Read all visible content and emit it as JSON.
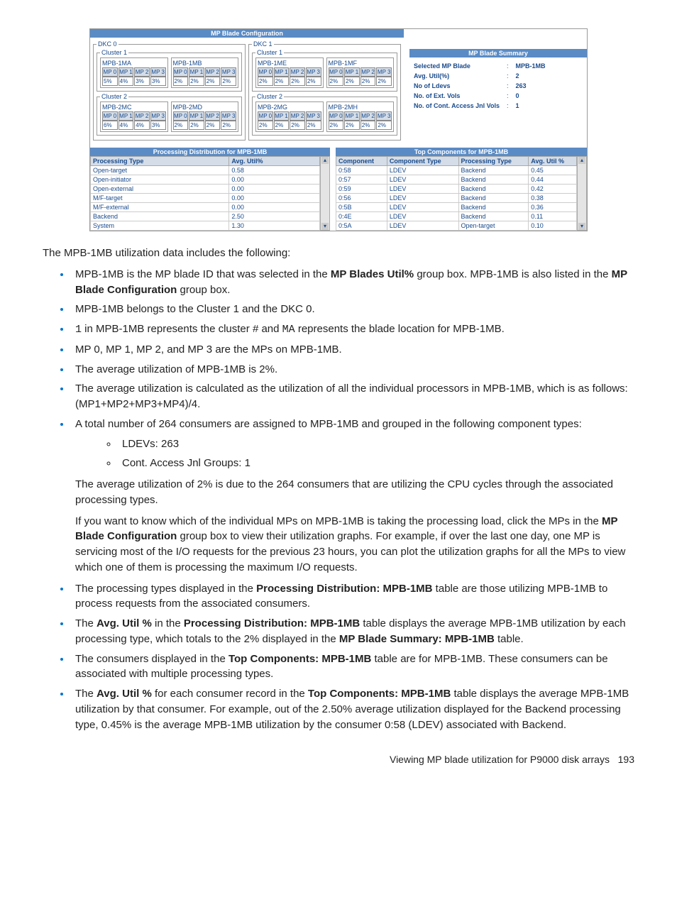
{
  "screenshot": {
    "title": "MP Blade Configuration",
    "dkcs": [
      {
        "label": "DKC 0",
        "clusters": [
          {
            "label": "Cluster 1",
            "blades": [
              {
                "name": "MPB-1MA",
                "mps": [
                  "MP 0",
                  "MP 1",
                  "MP 2",
                  "MP 3"
                ],
                "vals": [
                  "5%",
                  "4%",
                  "3%",
                  "3%"
                ]
              },
              {
                "name": "MPB-1MB",
                "mps": [
                  "MP 0",
                  "MP 1",
                  "MP 2",
                  "MP 3"
                ],
                "vals": [
                  "2%",
                  "2%",
                  "2%",
                  "2%"
                ]
              }
            ]
          },
          {
            "label": "Cluster 2",
            "blades": [
              {
                "name": "MPB-2MC",
                "mps": [
                  "MP 0",
                  "MP 1",
                  "MP 2",
                  "MP 3"
                ],
                "vals": [
                  "6%",
                  "4%",
                  "4%",
                  "3%"
                ]
              },
              {
                "name": "MPB-2MD",
                "mps": [
                  "MP 0",
                  "MP 1",
                  "MP 2",
                  "MP 3"
                ],
                "vals": [
                  "2%",
                  "2%",
                  "2%",
                  "2%"
                ]
              }
            ]
          }
        ]
      },
      {
        "label": "DKC 1",
        "clusters": [
          {
            "label": "Cluster 1",
            "blades": [
              {
                "name": "MPB-1ME",
                "mps": [
                  "MP 0",
                  "MP 1",
                  "MP 2",
                  "MP 3"
                ],
                "vals": [
                  "2%",
                  "2%",
                  "2%",
                  "2%"
                ]
              },
              {
                "name": "MPB-1MF",
                "mps": [
                  "MP 0",
                  "MP 1",
                  "MP 2",
                  "MP 3"
                ],
                "vals": [
                  "2%",
                  "2%",
                  "2%",
                  "2%"
                ]
              }
            ]
          },
          {
            "label": "Cluster 2",
            "blades": [
              {
                "name": "MPB-2MG",
                "mps": [
                  "MP 0",
                  "MP 1",
                  "MP 2",
                  "MP 3"
                ],
                "vals": [
                  "2%",
                  "2%",
                  "2%",
                  "2%"
                ]
              },
              {
                "name": "MPB-2MH",
                "mps": [
                  "MP 0",
                  "MP 1",
                  "MP 2",
                  "MP 3"
                ],
                "vals": [
                  "2%",
                  "2%",
                  "2%",
                  "2%"
                ]
              }
            ]
          }
        ]
      }
    ],
    "summary": {
      "header": "MP Blade Summary",
      "rows": [
        {
          "label": "Selected MP Blade",
          "value": "MPB-1MB"
        },
        {
          "label": "Avg. Util(%)",
          "value": "2"
        },
        {
          "label": "No of Ldevs",
          "value": "263"
        },
        {
          "label": "No. of Ext. Vols",
          "value": "0"
        },
        {
          "label": "No. of Cont. Access Jnl Vols",
          "value": "1"
        }
      ]
    },
    "procDist": {
      "header": "Processing Distribution for MPB-1MB",
      "cols": [
        "Processing Type",
        "Avg. Util%"
      ],
      "rows": [
        [
          "Open-target",
          "0.58"
        ],
        [
          "Open-initiator",
          "0.00"
        ],
        [
          "Open-external",
          "0.00"
        ],
        [
          "M/F-target",
          "0.00"
        ],
        [
          "M/F-external",
          "0.00"
        ],
        [
          "Backend",
          "2.50"
        ],
        [
          "System",
          "1.30"
        ]
      ]
    },
    "topComp": {
      "header": "Top Components for MPB-1MB",
      "cols": [
        "Component",
        "Component Type",
        "Processing Type",
        "Avg. Util %"
      ],
      "rows": [
        [
          "0:58",
          "LDEV",
          "Backend",
          "0.45"
        ],
        [
          "0:57",
          "LDEV",
          "Backend",
          "0.44"
        ],
        [
          "0:59",
          "LDEV",
          "Backend",
          "0.42"
        ],
        [
          "0:56",
          "LDEV",
          "Backend",
          "0.38"
        ],
        [
          "0:5B",
          "LDEV",
          "Backend",
          "0.36"
        ],
        [
          "0:4E",
          "LDEV",
          "Backend",
          "0.11"
        ],
        [
          "0:5A",
          "LDEV",
          "Open-target",
          "0.10"
        ]
      ]
    }
  },
  "text": {
    "intro": "The MPB-1MB utilization data includes the following:",
    "b1a": "MPB-1MB is the MP blade ID that was selected in the ",
    "b1b": "MP Blades Util%",
    "b1c": " group box. MPB-1MB is also listed in the ",
    "b1d": "MP Blade Configuration",
    "b1e": " group box.",
    "b2": "MPB-1MB belongs to the Cluster 1 and the DKC 0.",
    "b3a": "1",
    "b3b": " in MPB-1MB represents the cluster # and ",
    "b3c": "MA",
    "b3d": " represents the blade location for MPB-1MB.",
    "b4": "MP 0, MP 1, MP 2, and MP 3 are the MPs on MPB-1MB.",
    "b5": "The average utilization of MPB-1MB is 2%.",
    "b6": "The average utilization is calculated as the utilization of all the individual processors in MPB-1MB, which is as follows: (MP1+MP2+MP3+MP4)/4.",
    "b7": "A total number of 264 consumers are assigned to MPB-1MB and grouped in the following component types:",
    "b7s1": "LDEVs: 263",
    "b7s2": "Cont. Access Jnl Groups: 1",
    "p1": "The average utilization of 2% is due to the 264 consumers that are utilizing the CPU cycles through the associated processing types.",
    "p2a": "If you want to know which of the individual MPs on MPB-1MB is taking the processing load, click the MPs in the ",
    "p2b": "MP Blade Configuration",
    "p2c": " group box to view their utilization graphs. For example, if over the last one day, one MP is servicing most of the I/O requests for the previous 23 hours, you can plot the utilization graphs for all the MPs to view which one of them is processing the maximum I/O requests.",
    "b8a": "The processing types displayed in the ",
    "b8b": "Processing Distribution: MPB-1MB",
    "b8c": " table are those utilizing MPB-1MB to process requests from the associated consumers.",
    "b9a": "The ",
    "b9b": "Avg. Util %",
    "b9c": " in the ",
    "b9d": "Processing Distribution: MPB-1MB",
    "b9e": " table displays the average MPB-1MB utilization by each processing type, which totals to the 2% displayed in the ",
    "b9f": "MP Blade Summary: MPB-1MB",
    "b9g": " table.",
    "b10a": "The consumers displayed in the ",
    "b10b": "Top Components: MPB-1MB",
    "b10c": " table are for MPB-1MB. These consumers can be associated with multiple processing types.",
    "b11a": "The ",
    "b11b": "Avg. Util %",
    "b11c": " for each consumer record in the ",
    "b11d": "Top Components: MPB-1MB",
    "b11e": " table displays the average MPB-1MB utilization by that consumer. For example, out of the 2.50% average utilization displayed for the Backend processing type, 0.45% is the average MPB-1MB utilization by the consumer 0:58 (LDEV) associated with Backend.",
    "footer": "Viewing MP blade utilization for P9000 disk arrays",
    "pagenum": "193"
  }
}
